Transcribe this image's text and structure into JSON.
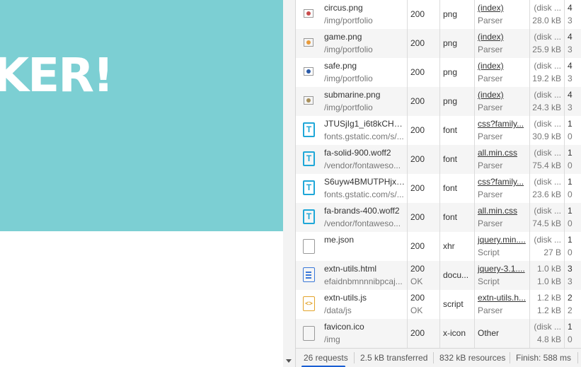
{
  "page": {
    "hero_text": "KER!",
    "hero_color": "#7ccfd3"
  },
  "requests": [
    {
      "name": "circus.png",
      "path": "/img/portfolio",
      "status": "200",
      "status2": "",
      "type": "png",
      "initiator": "(index)",
      "initiator2": "Parser",
      "size1": "(disk ...",
      "size2": "28.0 kB",
      "time1": "4",
      "time2": "3",
      "icon": "image-icon",
      "dot": "#c94d4d"
    },
    {
      "name": "game.png",
      "path": "/img/portfolio",
      "status": "200",
      "status2": "",
      "type": "png",
      "initiator": "(index)",
      "initiator2": "Parser",
      "size1": "(disk ...",
      "size2": "25.9 kB",
      "time1": "4",
      "time2": "3",
      "icon": "image-icon",
      "dot": "#e89a3a"
    },
    {
      "name": "safe.png",
      "path": "/img/portfolio",
      "status": "200",
      "status2": "",
      "type": "png",
      "initiator": "(index)",
      "initiator2": "Parser",
      "size1": "(disk ...",
      "size2": "19.2 kB",
      "time1": "4",
      "time2": "3",
      "icon": "image-icon",
      "dot": "#2b5ba8"
    },
    {
      "name": "submarine.png",
      "path": "/img/portfolio",
      "status": "200",
      "status2": "",
      "type": "png",
      "initiator": "(index)",
      "initiator2": "Parser",
      "size1": "(disk ...",
      "size2": "24.3 kB",
      "time1": "4",
      "time2": "3",
      "icon": "image-icon",
      "dot": "#a88f5a"
    },
    {
      "name": "JTUSjIg1_i6t8kCHK...",
      "path": "fonts.gstatic.com/s/...",
      "status": "200",
      "status2": "",
      "type": "font",
      "initiator": "css?family...",
      "initiator2": "Parser",
      "size1": "(disk ...",
      "size2": "30.9 kB",
      "time1": "1",
      "time2": "0",
      "icon": "font-icon"
    },
    {
      "name": "fa-solid-900.woff2",
      "path": "/vendor/fontaweso...",
      "status": "200",
      "status2": "",
      "type": "font",
      "initiator": "all.min.css",
      "initiator2": "Parser",
      "size1": "(disk ...",
      "size2": "75.4 kB",
      "time1": "1",
      "time2": "0",
      "icon": "font-icon"
    },
    {
      "name": "S6uyw4BMUTPHjx4...",
      "path": "fonts.gstatic.com/s/...",
      "status": "200",
      "status2": "",
      "type": "font",
      "initiator": "css?family...",
      "initiator2": "Parser",
      "size1": "(disk ...",
      "size2": "23.6 kB",
      "time1": "1",
      "time2": "0",
      "icon": "font-icon"
    },
    {
      "name": "fa-brands-400.woff2",
      "path": "/vendor/fontaweso...",
      "status": "200",
      "status2": "",
      "type": "font",
      "initiator": "all.min.css",
      "initiator2": "Parser",
      "size1": "(disk ...",
      "size2": "74.5 kB",
      "time1": "1",
      "time2": "0",
      "icon": "font-icon"
    },
    {
      "name": "me.json",
      "path": "",
      "status": "200",
      "status2": "",
      "type": "xhr",
      "initiator": "jquery.min....",
      "initiator2": "Script",
      "size1": "(disk ...",
      "size2": "27 B",
      "time1": "1",
      "time2": "0",
      "icon": "blank-icon"
    },
    {
      "name": "extn-utils.html",
      "path": "efaidnbmnnnibpcaj...",
      "status": "200",
      "status2": "OK",
      "type": "docu...",
      "initiator": "jquery-3.1....",
      "initiator2": "Script",
      "size1": "1.0 kB",
      "size2": "1.0 kB",
      "time1": "3",
      "time2": "3",
      "icon": "document-icon"
    },
    {
      "name": "extn-utils.js",
      "path": "/data/js",
      "status": "200",
      "status2": "OK",
      "type": "script",
      "initiator": "extn-utils.h...",
      "initiator2": "Parser",
      "size1": "1.2 kB",
      "size2": "1.2 kB",
      "time1": "2",
      "time2": "2",
      "icon": "script-icon"
    },
    {
      "name": "favicon.ico",
      "path": "/img",
      "status": "200",
      "status2": "",
      "type": "x-icon",
      "initiator": "Other",
      "initiator2": "",
      "size1": "(disk ...",
      "size2": "4.8 kB",
      "time1": "1",
      "time2": "0",
      "icon": "blank-icon"
    }
  ],
  "summary": {
    "requests": "26 requests",
    "transferred": "2.5 kB transferred",
    "resources": "832 kB resources",
    "finish": "Finish: 588 ms"
  }
}
